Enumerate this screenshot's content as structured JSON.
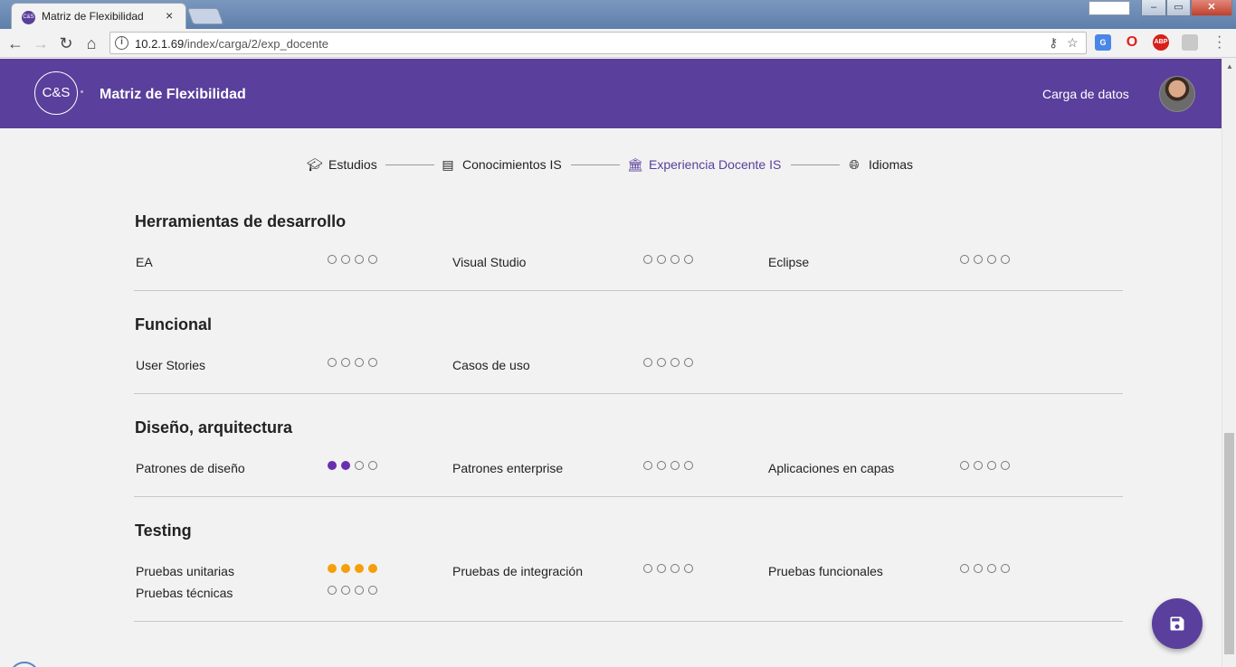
{
  "browser": {
    "tab_title": "Matriz de Flexibilidad",
    "tab_close": "×",
    "favicon_text": "C&S",
    "url_host": "10.2.1.69",
    "url_path": "/index/carga/2/exp_docente",
    "window_min": "‒",
    "window_max": "▭",
    "window_close": "✕"
  },
  "header": {
    "logo_text": "C&S",
    "app_title": "Matriz de Flexibilidad",
    "nav_link": "Carga de datos"
  },
  "steps": [
    {
      "label": "Estudios",
      "icon": "graduation-cap-icon",
      "active": false
    },
    {
      "label": "Conocimientos IS",
      "icon": "message-icon",
      "active": false
    },
    {
      "label": "Experiencia Docente IS",
      "icon": "institution-icon",
      "active": true
    },
    {
      "label": "Idiomas",
      "icon": "globe-icon",
      "active": false
    }
  ],
  "sections": [
    {
      "title": "Herramientas de desarrollo",
      "skills": [
        {
          "label": "EA",
          "level": 0,
          "color": "#6a2fb0"
        },
        {
          "label": "Visual Studio",
          "level": 0,
          "color": "#6a2fb0"
        },
        {
          "label": "Eclipse",
          "level": 0,
          "color": "#6a2fb0"
        }
      ]
    },
    {
      "title": "Funcional",
      "skills": [
        {
          "label": "User Stories",
          "level": 0,
          "color": "#6a2fb0"
        },
        {
          "label": "Casos de uso",
          "level": 0,
          "color": "#6a2fb0"
        }
      ]
    },
    {
      "title": "Diseño, arquitectura",
      "skills": [
        {
          "label": "Patrones de diseño",
          "level": 2,
          "color": "#6a2fb0"
        },
        {
          "label": "Patrones enterprise",
          "level": 0,
          "color": "#6a2fb0"
        },
        {
          "label": "Aplicaciones en capas",
          "level": 0,
          "color": "#6a2fb0"
        }
      ]
    },
    {
      "title": "Testing",
      "skills": [
        {
          "label": "Pruebas unitarias",
          "level": 4,
          "color": "#f59f0a"
        },
        {
          "label": "Pruebas de integración",
          "level": 0,
          "color": "#f59f0a"
        },
        {
          "label": "Pruebas funcionales",
          "level": 0,
          "color": "#f59f0a"
        },
        {
          "label": "Pruebas técnicas",
          "level": 0,
          "color": "#f59f0a"
        }
      ]
    }
  ],
  "rating_max": 4,
  "colors": {
    "brand": "#5a3f9c",
    "rating_purple": "#6a2fb0",
    "rating_orange": "#f59f0a"
  },
  "fab": {
    "icon": "save-icon"
  }
}
